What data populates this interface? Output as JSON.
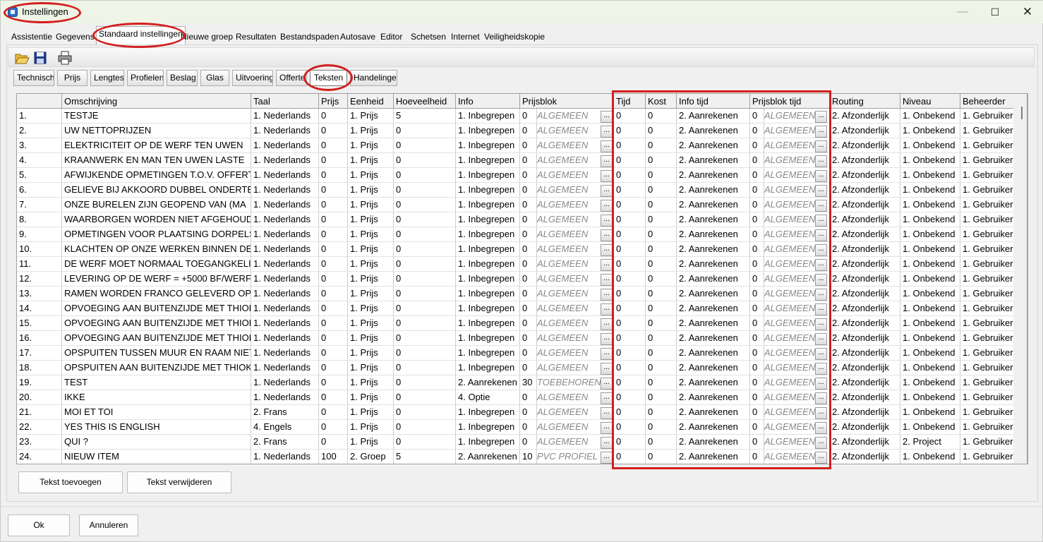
{
  "window": {
    "title": "Instellingen",
    "controls": {
      "minimize": "—",
      "maximize": "☐",
      "close": "✕"
    }
  },
  "tabs": [
    "Assistentie",
    "Gegevens",
    "Standaard instellingen",
    "Nieuwe groep",
    "Resultaten",
    "Bestandspaden",
    "Autosave",
    "Editor",
    "Schetsen",
    "Internet",
    "Veiligheidskopie"
  ],
  "active_tab": "Standaard instellingen",
  "toolbar": {
    "icons": [
      "open-folder-icon",
      "save-disk-icon",
      "print-icon"
    ]
  },
  "subtabs": [
    "Technisch",
    "Prijs",
    "Lengtes",
    "Profielen",
    "Beslag",
    "Glas",
    "Uitvoering",
    "Offerte",
    "Teksten",
    "Handelingen"
  ],
  "active_subtab": "Teksten",
  "grid": {
    "columns": [
      "",
      "Omschrijving",
      "Taal",
      "Prijs",
      "Eenheid",
      "Hoeveelheid",
      "Info",
      "Prijsblok",
      "Tijd",
      "Kost",
      "Info tijd",
      "Prijsblok tijd",
      "Routing",
      "Niveau",
      "Beheerder"
    ],
    "ellipsis": "...",
    "rows": [
      [
        "1.",
        "TESTJE",
        "1. Nederlands",
        "0",
        "1. Prijs",
        "5",
        "1. Inbegrepen",
        "0",
        "ALGEMEEN",
        "0",
        "0",
        "2. Aanrekenen",
        "0",
        "ALGEMEEN",
        "2. Afzonderlijk",
        "1. Onbekend",
        "1. Gebruiker"
      ],
      [
        "2.",
        "UW NETTOPRIJZEN",
        "1. Nederlands",
        "0",
        "1. Prijs",
        "0",
        "1. Inbegrepen",
        "0",
        "ALGEMEEN",
        "0",
        "0",
        "2. Aanrekenen",
        "0",
        "ALGEMEEN",
        "2. Afzonderlijk",
        "1. Onbekend",
        "1. Gebruiker"
      ],
      [
        "3.",
        "ELEKTRICITEIT OP DE WERF TEN UWEN",
        "1. Nederlands",
        "0",
        "1. Prijs",
        "0",
        "1. Inbegrepen",
        "0",
        "ALGEMEEN",
        "0",
        "0",
        "2. Aanrekenen",
        "0",
        "ALGEMEEN",
        "2. Afzonderlijk",
        "1. Onbekend",
        "1. Gebruiker"
      ],
      [
        "4.",
        "KRAANWERK EN MAN TEN UWEN LASTE",
        "1. Nederlands",
        "0",
        "1. Prijs",
        "0",
        "1. Inbegrepen",
        "0",
        "ALGEMEEN",
        "0",
        "0",
        "2. Aanrekenen",
        "0",
        "ALGEMEEN",
        "2. Afzonderlijk",
        "1. Onbekend",
        "1. Gebruiker"
      ],
      [
        "5.",
        "AFWIJKENDE OPMETINGEN T.O.V. OFFERTE",
        "1. Nederlands",
        "0",
        "1. Prijs",
        "0",
        "1. Inbegrepen",
        "0",
        "ALGEMEEN",
        "0",
        "0",
        "2. Aanrekenen",
        "0",
        "ALGEMEEN",
        "2. Afzonderlijk",
        "1. Onbekend",
        "1. Gebruiker"
      ],
      [
        "6.",
        "GELIEVE BIJ AKKOORD DUBBEL ONDERTEKENEN",
        "1. Nederlands",
        "0",
        "1. Prijs",
        "0",
        "1. Inbegrepen",
        "0",
        "ALGEMEEN",
        "0",
        "0",
        "2. Aanrekenen",
        "0",
        "ALGEMEEN",
        "2. Afzonderlijk",
        "1. Onbekend",
        "1. Gebruiker"
      ],
      [
        "7.",
        "ONZE BURELEN ZIJN GEOPEND VAN (MA",
        "1. Nederlands",
        "0",
        "1. Prijs",
        "0",
        "1. Inbegrepen",
        "0",
        "ALGEMEEN",
        "0",
        "0",
        "2. Aanrekenen",
        "0",
        "ALGEMEEN",
        "2. Afzonderlijk",
        "1. Onbekend",
        "1. Gebruiker"
      ],
      [
        "8.",
        "WAARBORGEN WORDEN NIET AFGEHOUDEN",
        "1. Nederlands",
        "0",
        "1. Prijs",
        "0",
        "1. Inbegrepen",
        "0",
        "ALGEMEEN",
        "0",
        "0",
        "2. Aanrekenen",
        "0",
        "ALGEMEEN",
        "2. Afzonderlijk",
        "1. Onbekend",
        "1. Gebruiker"
      ],
      [
        "9.",
        "OPMETINGEN VOOR PLAATSING DORPELS",
        "1. Nederlands",
        "0",
        "1. Prijs",
        "0",
        "1. Inbegrepen",
        "0",
        "ALGEMEEN",
        "0",
        "0",
        "2. Aanrekenen",
        "0",
        "ALGEMEEN",
        "2. Afzonderlijk",
        "1. Onbekend",
        "1. Gebruiker"
      ],
      [
        "10.",
        "KLACHTEN OP ONZE WERKEN BINNEN DE",
        "1. Nederlands",
        "0",
        "1. Prijs",
        "0",
        "1. Inbegrepen",
        "0",
        "ALGEMEEN",
        "0",
        "0",
        "2. Aanrekenen",
        "0",
        "ALGEMEEN",
        "2. Afzonderlijk",
        "1. Onbekend",
        "1. Gebruiker"
      ],
      [
        "11.",
        "DE WERF MOET NORMAAL TOEGANGKELIJK",
        "1. Nederlands",
        "0",
        "1. Prijs",
        "0",
        "1. Inbegrepen",
        "0",
        "ALGEMEEN",
        "0",
        "0",
        "2. Aanrekenen",
        "0",
        "ALGEMEEN",
        "2. Afzonderlijk",
        "1. Onbekend",
        "1. Gebruiker"
      ],
      [
        "12.",
        "LEVERING OP DE WERF = +5000 BF/WERF",
        "1. Nederlands",
        "0",
        "1. Prijs",
        "0",
        "1. Inbegrepen",
        "0",
        "ALGEMEEN",
        "0",
        "0",
        "2. Aanrekenen",
        "0",
        "ALGEMEEN",
        "2. Afzonderlijk",
        "1. Onbekend",
        "1. Gebruiker"
      ],
      [
        "13.",
        "RAMEN WORDEN FRANCO GELEVERD OP",
        "1. Nederlands",
        "0",
        "1. Prijs",
        "0",
        "1. Inbegrepen",
        "0",
        "ALGEMEEN",
        "0",
        "0",
        "2. Aanrekenen",
        "0",
        "ALGEMEEN",
        "2. Afzonderlijk",
        "1. Onbekend",
        "1. Gebruiker"
      ],
      [
        "14.",
        "OPVOEGING AAN BUITENZIJDE MET THIOKOL",
        "1. Nederlands",
        "0",
        "1. Prijs",
        "0",
        "1. Inbegrepen",
        "0",
        "ALGEMEEN",
        "0",
        "0",
        "2. Aanrekenen",
        "0",
        "ALGEMEEN",
        "2. Afzonderlijk",
        "1. Onbekend",
        "1. Gebruiker"
      ],
      [
        "15.",
        "OPVOEGING AAN BUITENZIJDE MET THIOKOL",
        "1. Nederlands",
        "0",
        "1. Prijs",
        "0",
        "1. Inbegrepen",
        "0",
        "ALGEMEEN",
        "0",
        "0",
        "2. Aanrekenen",
        "0",
        "ALGEMEEN",
        "2. Afzonderlijk",
        "1. Onbekend",
        "1. Gebruiker"
      ],
      [
        "16.",
        "OPVOEGING AAN BUITENZIJDE MET THIOKOL",
        "1. Nederlands",
        "0",
        "1. Prijs",
        "0",
        "1. Inbegrepen",
        "0",
        "ALGEMEEN",
        "0",
        "0",
        "2. Aanrekenen",
        "0",
        "ALGEMEEN",
        "2. Afzonderlijk",
        "1. Onbekend",
        "1. Gebruiker"
      ],
      [
        "17.",
        "OPSPUITEN TUSSEN MUUR EN RAAM NIET",
        "1. Nederlands",
        "0",
        "1. Prijs",
        "0",
        "1. Inbegrepen",
        "0",
        "ALGEMEEN",
        "0",
        "0",
        "2. Aanrekenen",
        "0",
        "ALGEMEEN",
        "2. Afzonderlijk",
        "1. Onbekend",
        "1. Gebruiker"
      ],
      [
        "18.",
        "OPSPUITEN AAN BUITENZIJDE MET THIOKOL",
        "1. Nederlands",
        "0",
        "1. Prijs",
        "0",
        "1. Inbegrepen",
        "0",
        "ALGEMEEN",
        "0",
        "0",
        "2. Aanrekenen",
        "0",
        "ALGEMEEN",
        "2. Afzonderlijk",
        "1. Onbekend",
        "1. Gebruiker"
      ],
      [
        "19.",
        "TEST",
        "1. Nederlands",
        "0",
        "1. Prijs",
        "0",
        "2. Aanrekenen",
        "30",
        "TOEBEHOREN",
        "0",
        "0",
        "2. Aanrekenen",
        "0",
        "ALGEMEEN",
        "2. Afzonderlijk",
        "1. Onbekend",
        "1. Gebruiker"
      ],
      [
        "20.",
        "IKKE",
        "1. Nederlands",
        "0",
        "1. Prijs",
        "0",
        "4. Optie",
        "0",
        "ALGEMEEN",
        "0",
        "0",
        "2. Aanrekenen",
        "0",
        "ALGEMEEN",
        "2. Afzonderlijk",
        "1. Onbekend",
        "1. Gebruiker"
      ],
      [
        "21.",
        "MOI ET TOI",
        "2. Frans",
        "0",
        "1. Prijs",
        "0",
        "1. Inbegrepen",
        "0",
        "ALGEMEEN",
        "0",
        "0",
        "2. Aanrekenen",
        "0",
        "ALGEMEEN",
        "2. Afzonderlijk",
        "1. Onbekend",
        "1. Gebruiker"
      ],
      [
        "22.",
        "YES THIS IS ENGLISH",
        "4. Engels",
        "0",
        "1. Prijs",
        "0",
        "1. Inbegrepen",
        "0",
        "ALGEMEEN",
        "0",
        "0",
        "2. Aanrekenen",
        "0",
        "ALGEMEEN",
        "2. Afzonderlijk",
        "1. Onbekend",
        "1. Gebruiker"
      ],
      [
        "23.",
        "QUI ?",
        "2. Frans",
        "0",
        "1. Prijs",
        "0",
        "1. Inbegrepen",
        "0",
        "ALGEMEEN",
        "0",
        "0",
        "2. Aanrekenen",
        "0",
        "ALGEMEEN",
        "2. Afzonderlijk",
        "2. Project",
        "1. Gebruiker"
      ],
      [
        "24.",
        "NIEUW ITEM",
        "1. Nederlands",
        "100",
        "2. Groep",
        "5",
        "2. Aanrekenen",
        "10",
        "PVC PROFIEL",
        "0",
        "0",
        "2. Aanrekenen",
        "0",
        "ALGEMEEN",
        "2. Afzonderlijk",
        "1. Onbekend",
        "1. Gebruiker"
      ]
    ]
  },
  "buttons": {
    "add_text": "Tekst toevoegen",
    "remove_text": "Tekst verwijderen",
    "ok": "Ok",
    "cancel": "Annuleren"
  },
  "colors": {
    "highlight": "#d31e1e",
    "titlebar": "#eef5e6"
  }
}
